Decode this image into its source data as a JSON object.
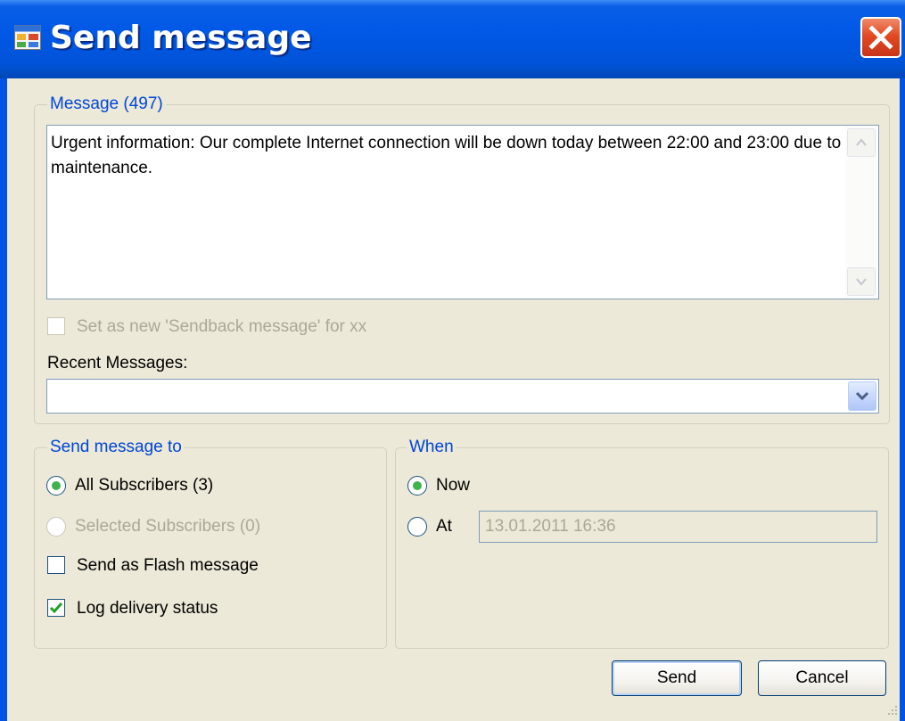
{
  "window": {
    "title": "Send message",
    "close_icon": "close-icon"
  },
  "message_group": {
    "legend": "Message (497)",
    "text": "Urgent information: Our complete Internet connection will be down today between 22:00 and 23:00 due to maintenance.",
    "sendback_checkbox": {
      "label": "Set as new 'Sendback message' for xx",
      "checked": false,
      "enabled": false
    },
    "recent_label": "Recent Messages:",
    "recent_value": ""
  },
  "send_to_group": {
    "legend": "Send message to",
    "all_subscribers": {
      "label": "All Subscribers (3)",
      "selected": true
    },
    "selected_subscribers": {
      "label": "Selected Subscribers (0)",
      "selected": false,
      "enabled": false
    },
    "flash_message": {
      "label": "Send as Flash message",
      "checked": false
    },
    "log_delivery": {
      "label": "Log delivery status",
      "checked": true
    }
  },
  "when_group": {
    "legend": "When",
    "now": {
      "label": "Now",
      "selected": true
    },
    "at": {
      "label": "At",
      "selected": false
    },
    "datetime_value": "13.01.2011 16:36"
  },
  "buttons": {
    "send": "Send",
    "cancel": "Cancel"
  },
  "colors": {
    "titlebar": "#0054e3",
    "legend_text": "#0046d5",
    "dialog_bg": "#ece9d8",
    "radio_dot": "#3fb24b",
    "check_mark": "#21a121"
  }
}
